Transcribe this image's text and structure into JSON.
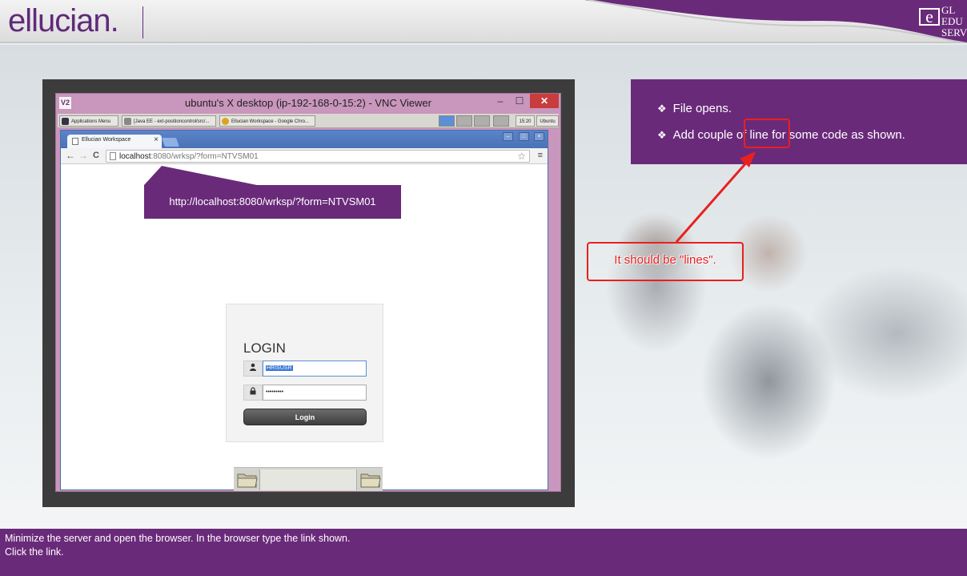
{
  "header": {
    "logo_text": "ellucian.",
    "brand_letter": "e",
    "brand_lines": [
      "GL",
      "EDU",
      "SERVI"
    ]
  },
  "vnc": {
    "title": "ubuntu's X desktop (ip-192-168-0-15:2) - VNC Viewer",
    "icon_label": "V2",
    "min_glyph": "–",
    "max_glyph": "☐",
    "close_glyph": "✕",
    "taskbar": {
      "items": [
        "Applications Menu",
        "[Java EE - ext-positioncontrol/src/...",
        "Ellucian Workspace - Google Chro..."
      ],
      "clock": "15:20",
      "user": "Ubuntu"
    }
  },
  "browser": {
    "tab_label": "Ellucian Workspace",
    "tab_close": "×",
    "address_host": "localhost",
    "address_rest": ":8080/wrksp/?form=NTVSM01",
    "back_glyph": "←",
    "forward_glyph": "→",
    "reload_glyph": "C",
    "star_glyph": "☆",
    "menu_glyph": "≡",
    "win_ctrls": [
      "–",
      "□",
      "×"
    ]
  },
  "callout": {
    "text": "http://localhost:8080/wrksp/?form=NTVSM01"
  },
  "login": {
    "title": "LOGIN",
    "username_value": "HRISUSR",
    "password_value": "•••••••••",
    "button_label": "Login",
    "user_icon": "👤",
    "lock_icon": "🔒"
  },
  "info": {
    "items": [
      {
        "bullet": "❖",
        "text": "File opens."
      },
      {
        "bullet": "❖",
        "text": "Add couple of line for some code as shown."
      }
    ]
  },
  "annotation": {
    "note": "It should be \"lines\".",
    "color": "#e82020"
  },
  "footer": {
    "line1": "Minimize the server and open the browser. In the browser type the link shown.",
    "line2": "Click the link."
  },
  "colors": {
    "brand_purple": "#6a2a7a",
    "annotation_red": "#e82020"
  }
}
